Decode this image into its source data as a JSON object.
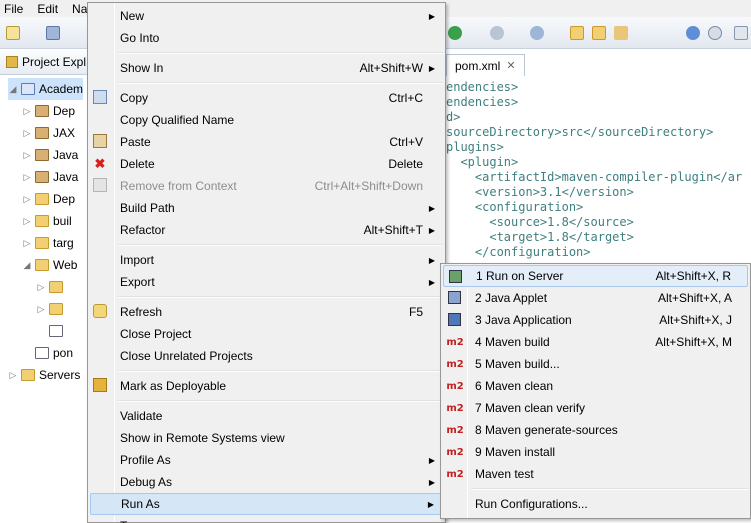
{
  "menubar": {
    "items": [
      "File",
      "Edit",
      "Na"
    ]
  },
  "explorer": {
    "title": "Project Expl",
    "tree": [
      {
        "label": "Academ",
        "tri": "◢",
        "indent": 0,
        "icon": "project-icon",
        "cls": "proj",
        "selected": true
      },
      {
        "label": "Dep",
        "tri": "▷",
        "indent": 1,
        "icon": "library-icon",
        "cls": "jar"
      },
      {
        "label": "JAX",
        "tri": "▷",
        "indent": 1,
        "icon": "jaxws-icon",
        "cls": "jar"
      },
      {
        "label": "Java",
        "tri": "▷",
        "indent": 1,
        "icon": "java-resources-icon",
        "cls": "jar"
      },
      {
        "label": "Java",
        "tri": "▷",
        "indent": 1,
        "icon": "java-library-icon",
        "cls": "jar"
      },
      {
        "label": "Dep",
        "tri": "▷",
        "indent": 1,
        "icon": "deployed-resources-icon",
        "cls": "fold"
      },
      {
        "label": "buil",
        "tri": "▷",
        "indent": 1,
        "icon": "folder-icon",
        "cls": "fold"
      },
      {
        "label": "targ",
        "tri": "▷",
        "indent": 1,
        "icon": "folder-icon",
        "cls": "fold"
      },
      {
        "label": "Web",
        "tri": "◢",
        "indent": 1,
        "icon": "folder-icon",
        "cls": "fold"
      },
      {
        "label": "",
        "tri": "▷",
        "indent": 2,
        "icon": "folder-icon",
        "cls": "fold"
      },
      {
        "label": "",
        "tri": "▷",
        "indent": 2,
        "icon": "folder-icon",
        "cls": "fold"
      },
      {
        "label": "",
        "tri": "",
        "indent": 2,
        "icon": "file-icon",
        "cls": "xml"
      },
      {
        "label": "pon",
        "tri": "",
        "indent": 1,
        "icon": "pom-file-icon",
        "cls": "xml"
      },
      {
        "label": "Servers",
        "tri": "▷",
        "indent": 0,
        "icon": "folder-icon",
        "cls": "fold"
      }
    ]
  },
  "editor": {
    "tab": "pom.xml",
    "lines": [
      "endencies>",
      "endencies>",
      "d>",
      "sourceDirectory>src</sourceDirectory>",
      "plugins>",
      "  <plugin>",
      "    <artifactId>maven-compiler-plugin</ar",
      "    <version>3.1</version>",
      "    <configuration>",
      "      <source>1.8</source>",
      "      <target>1.8</target>",
      "    </configuration>"
    ]
  },
  "context_menu": {
    "items": [
      {
        "type": "item",
        "label": "New",
        "submenu": true,
        "name": "new"
      },
      {
        "type": "item",
        "label": "Go Into",
        "name": "go-into"
      },
      {
        "type": "sep"
      },
      {
        "type": "item",
        "label": "Show In",
        "shortcut": "Alt+Shift+W",
        "submenu": true,
        "name": "show-in"
      },
      {
        "type": "sep"
      },
      {
        "type": "item",
        "label": "Copy",
        "shortcut": "Ctrl+C",
        "icon": "copy-icon",
        "name": "copy"
      },
      {
        "type": "item",
        "label": "Copy Qualified Name",
        "name": "copy-qualified-name"
      },
      {
        "type": "item",
        "label": "Paste",
        "shortcut": "Ctrl+V",
        "icon": "paste-icon",
        "name": "paste"
      },
      {
        "type": "item",
        "label": "Delete",
        "shortcut": "Delete",
        "icon": "delete-icon",
        "name": "delete"
      },
      {
        "type": "item",
        "label": "Remove from Context",
        "shortcut": "Ctrl+Alt+Shift+Down",
        "disabled": true,
        "icon": "remove-context-icon",
        "name": "remove-from-context"
      },
      {
        "type": "item",
        "label": "Build Path",
        "submenu": true,
        "name": "build-path"
      },
      {
        "type": "item",
        "label": "Refactor",
        "shortcut": "Alt+Shift+T",
        "submenu": true,
        "name": "refactor"
      },
      {
        "type": "sep"
      },
      {
        "type": "item",
        "label": "Import",
        "submenu": true,
        "name": "import"
      },
      {
        "type": "item",
        "label": "Export",
        "submenu": true,
        "name": "export"
      },
      {
        "type": "sep"
      },
      {
        "type": "item",
        "label": "Refresh",
        "shortcut": "F5",
        "icon": "refresh-icon",
        "name": "refresh"
      },
      {
        "type": "item",
        "label": "Close Project",
        "name": "close-project"
      },
      {
        "type": "item",
        "label": "Close Unrelated Projects",
        "name": "close-unrelated-projects"
      },
      {
        "type": "sep"
      },
      {
        "type": "item",
        "label": "Mark as Deployable",
        "icon": "deploy-icon",
        "name": "mark-as-deployable"
      },
      {
        "type": "sep"
      },
      {
        "type": "item",
        "label": "Validate",
        "name": "validate"
      },
      {
        "type": "item",
        "label": "Show in Remote Systems view",
        "name": "show-in-remote-systems"
      },
      {
        "type": "item",
        "label": "Profile As",
        "submenu": true,
        "name": "profile-as"
      },
      {
        "type": "item",
        "label": "Debug As",
        "submenu": true,
        "name": "debug-as"
      },
      {
        "type": "item",
        "label": "Run As",
        "submenu": true,
        "highlight": true,
        "name": "run-as"
      },
      {
        "type": "item",
        "label": "Te",
        "submenu": false,
        "name": "team"
      }
    ]
  },
  "run_as_submenu": {
    "items": [
      {
        "type": "item",
        "label": "1 Run on Server",
        "shortcut": "Alt+Shift+X, R",
        "icon": "server-icon",
        "highlight": true
      },
      {
        "type": "item",
        "label": "2 Java Applet",
        "shortcut": "Alt+Shift+X, A",
        "icon": "applet-icon"
      },
      {
        "type": "item",
        "label": "3 Java Application",
        "shortcut": "Alt+Shift+X, J",
        "icon": "java-app-icon"
      },
      {
        "type": "item",
        "label": "4 Maven build",
        "shortcut": "Alt+Shift+X, M",
        "icon": "m2-icon",
        "m2": "m2"
      },
      {
        "type": "item",
        "label": "5 Maven build...",
        "icon": "m2-icon",
        "m2": "m2"
      },
      {
        "type": "item",
        "label": "6 Maven clean",
        "icon": "m2-icon",
        "m2": "m2"
      },
      {
        "type": "item",
        "label": "7 Maven clean verify",
        "icon": "m2-icon",
        "m2": "m2"
      },
      {
        "type": "item",
        "label": "8 Maven generate-sources",
        "icon": "m2-icon",
        "m2": "m2"
      },
      {
        "type": "item",
        "label": "9 Maven install",
        "icon": "m2-icon",
        "m2": "m2"
      },
      {
        "type": "item",
        "label": "Maven test",
        "icon": "m2-icon",
        "m2": "m2"
      },
      {
        "type": "sep"
      },
      {
        "type": "item",
        "label": "Run Configurations..."
      }
    ]
  }
}
